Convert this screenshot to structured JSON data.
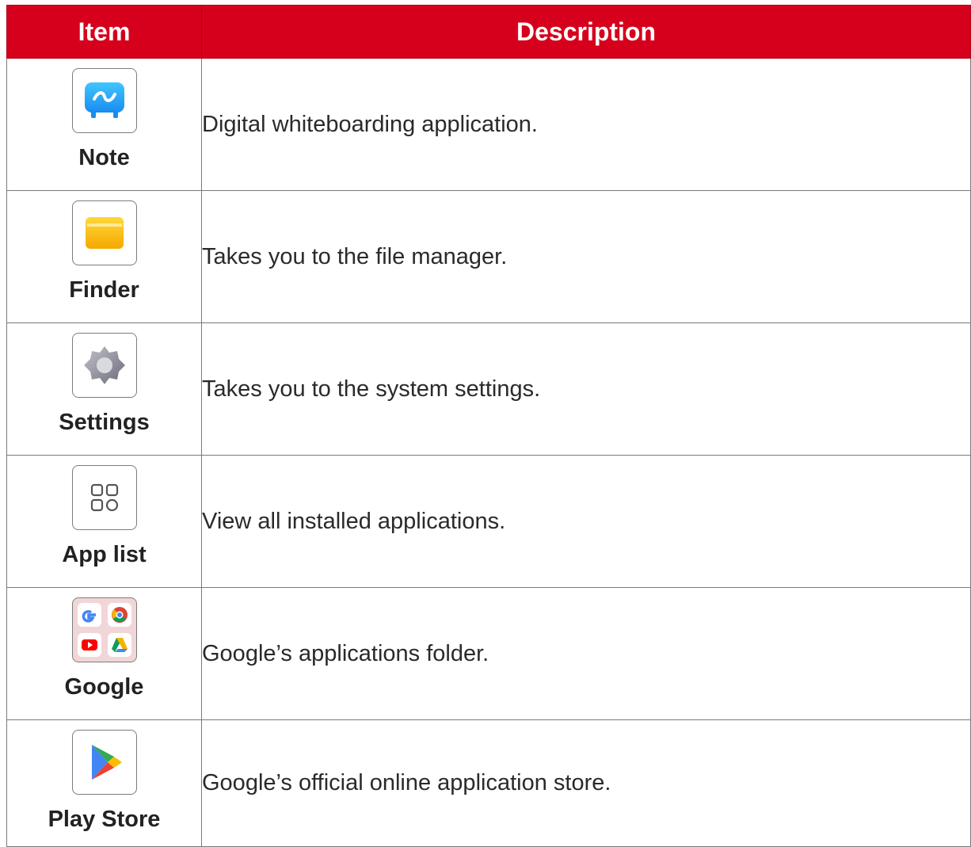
{
  "table": {
    "headers": {
      "item": "Item",
      "description": "Description"
    },
    "header_color": "#d6001c",
    "rows": [
      {
        "label": "Note",
        "icon": "note-app-icon",
        "description": "Digital whiteboarding application."
      },
      {
        "label": "Finder",
        "icon": "folder-icon",
        "description": "Takes you to the file manager."
      },
      {
        "label": "Settings",
        "icon": "gear-icon",
        "description": "Takes you to the system settings."
      },
      {
        "label": "App list",
        "icon": "app-grid-icon",
        "description": "View all installed applications."
      },
      {
        "label": "Google",
        "icon": "google-folder-icon",
        "description": "Google’s applications folder."
      },
      {
        "label": "Play Store",
        "icon": "play-store-icon",
        "description": "Google’s official online application store."
      }
    ]
  }
}
